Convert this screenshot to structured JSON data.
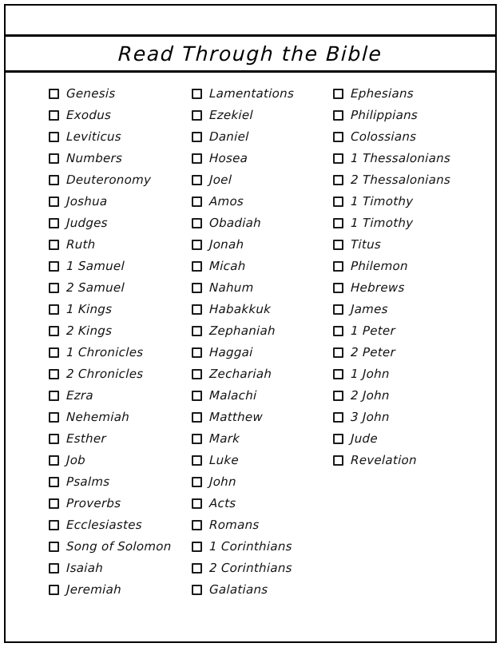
{
  "page": {
    "title": "Read Through the Bible",
    "frame_color": "#000000",
    "background_color": "#ffffff",
    "text_color": "#111111"
  },
  "checklist": {
    "columns": [
      {
        "name": "column-1",
        "items": [
          {
            "label": "Genesis",
            "checked": false
          },
          {
            "label": "Exodus",
            "checked": false
          },
          {
            "label": "Leviticus",
            "checked": false
          },
          {
            "label": "Numbers",
            "checked": false
          },
          {
            "label": "Deuteronomy",
            "checked": false
          },
          {
            "label": "Joshua",
            "checked": false
          },
          {
            "label": "Judges",
            "checked": false
          },
          {
            "label": "Ruth",
            "checked": false
          },
          {
            "label": "1 Samuel",
            "checked": false
          },
          {
            "label": "2 Samuel",
            "checked": false
          },
          {
            "label": "1 Kings",
            "checked": false
          },
          {
            "label": "2 Kings",
            "checked": false
          },
          {
            "label": "1 Chronicles",
            "checked": false
          },
          {
            "label": "2 Chronicles",
            "checked": false
          },
          {
            "label": "Ezra",
            "checked": false
          },
          {
            "label": "Nehemiah",
            "checked": false
          },
          {
            "label": "Esther",
            "checked": false
          },
          {
            "label": "Job",
            "checked": false
          },
          {
            "label": "Psalms",
            "checked": false
          },
          {
            "label": "Proverbs",
            "checked": false
          },
          {
            "label": "Ecclesiastes",
            "checked": false
          },
          {
            "label": "Song of Solomon",
            "checked": false
          },
          {
            "label": "Isaiah",
            "checked": false
          },
          {
            "label": "Jeremiah",
            "checked": false
          }
        ]
      },
      {
        "name": "column-2",
        "items": [
          {
            "label": "Lamentations",
            "checked": false
          },
          {
            "label": "Ezekiel",
            "checked": false
          },
          {
            "label": "Daniel",
            "checked": false
          },
          {
            "label": "Hosea",
            "checked": false
          },
          {
            "label": "Joel",
            "checked": false
          },
          {
            "label": "Amos",
            "checked": false
          },
          {
            "label": "Obadiah",
            "checked": false
          },
          {
            "label": "Jonah",
            "checked": false
          },
          {
            "label": "Micah",
            "checked": false
          },
          {
            "label": "Nahum",
            "checked": false
          },
          {
            "label": "Habakkuk",
            "checked": false
          },
          {
            "label": "Zephaniah",
            "checked": false
          },
          {
            "label": "Haggai",
            "checked": false
          },
          {
            "label": "Zechariah",
            "checked": false
          },
          {
            "label": "Malachi",
            "checked": false
          },
          {
            "label": "Matthew",
            "checked": false
          },
          {
            "label": "Mark",
            "checked": false
          },
          {
            "label": "Luke",
            "checked": false
          },
          {
            "label": "John",
            "checked": false
          },
          {
            "label": "Acts",
            "checked": false
          },
          {
            "label": "Romans",
            "checked": false
          },
          {
            "label": "1 Corinthians",
            "checked": false
          },
          {
            "label": "2 Corinthians",
            "checked": false
          },
          {
            "label": "Galatians",
            "checked": false
          }
        ]
      },
      {
        "name": "column-3",
        "items": [
          {
            "label": "Ephesians",
            "checked": false
          },
          {
            "label": "Philippians",
            "checked": false
          },
          {
            "label": "Colossians",
            "checked": false
          },
          {
            "label": "1 Thessalonians",
            "checked": false
          },
          {
            "label": "2 Thessalonians",
            "checked": false
          },
          {
            "label": "1 Timothy",
            "checked": false
          },
          {
            "label": "1 Timothy",
            "checked": false
          },
          {
            "label": "Titus",
            "checked": false
          },
          {
            "label": "Philemon",
            "checked": false
          },
          {
            "label": "Hebrews",
            "checked": false
          },
          {
            "label": "James",
            "checked": false
          },
          {
            "label": "1 Peter",
            "checked": false
          },
          {
            "label": "2 Peter",
            "checked": false
          },
          {
            "label": "1 John",
            "checked": false
          },
          {
            "label": "2 John",
            "checked": false
          },
          {
            "label": "3 John",
            "checked": false
          },
          {
            "label": "Jude",
            "checked": false
          },
          {
            "label": "Revelation",
            "checked": false
          }
        ]
      }
    ]
  }
}
